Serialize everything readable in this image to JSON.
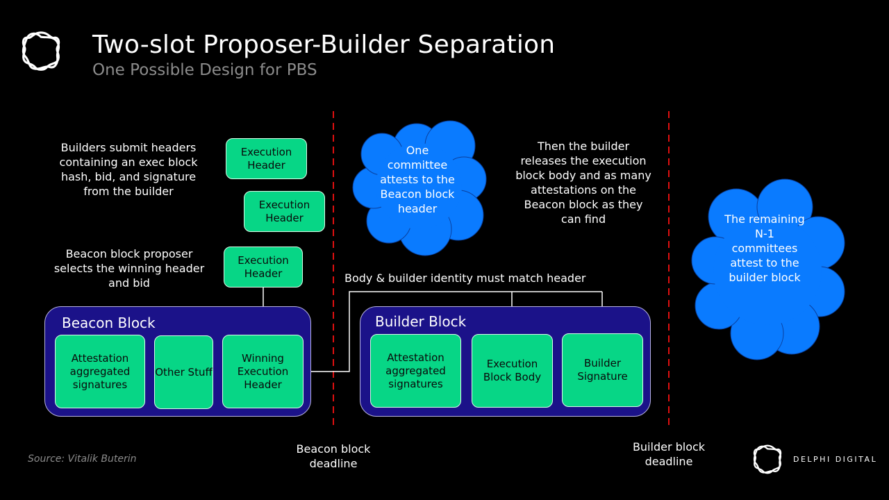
{
  "header": {
    "title": "Two-slot Proposer-Builder Separation",
    "subtitle": "One Possible Design for PBS",
    "logo_icon": "delphi-knot-logo"
  },
  "colors": {
    "background": "#000000",
    "green_box": "#07d686",
    "block_container": "#1b1289",
    "cloud": "#0a7bff",
    "deadline_line": "#e01010",
    "subtitle_gray": "#8c8c8c"
  },
  "notes": {
    "builders_submit": "Builders submit headers containing an exec block hash, bid, and signature from the builder",
    "proposer_selects": "Beacon block proposer selects the winning header and bid",
    "builder_releases": "Then the builder releases the execution block body and as many attestations on the Beacon block as they can find",
    "match_label": "Body & builder identity must match header"
  },
  "execution_headers": [
    {
      "label": "Execution Header"
    },
    {
      "label": "Execution Header"
    },
    {
      "label": "Execution Header"
    }
  ],
  "beacon_block": {
    "title": "Beacon Block",
    "items": [
      {
        "label": "Attestation aggregated signatures"
      },
      {
        "label": "Other Stuff"
      },
      {
        "label": "Winning Execution Header"
      }
    ]
  },
  "builder_block": {
    "title": "Builder Block",
    "items": [
      {
        "label": "Attestation aggregated signatures"
      },
      {
        "label": "Execution Block Body"
      },
      {
        "label": "Builder Signature"
      }
    ]
  },
  "clouds": {
    "one_committee": "One committee attests to the Beacon block header",
    "remaining_committees": "The remaining N-1 committees attest to the builder block"
  },
  "deadlines": {
    "beacon": "Beacon block deadline",
    "builder": "Builder block deadline"
  },
  "footer": {
    "source": "Source: Vitalik Buterin",
    "brand": "DELPHI DIGITAL"
  }
}
